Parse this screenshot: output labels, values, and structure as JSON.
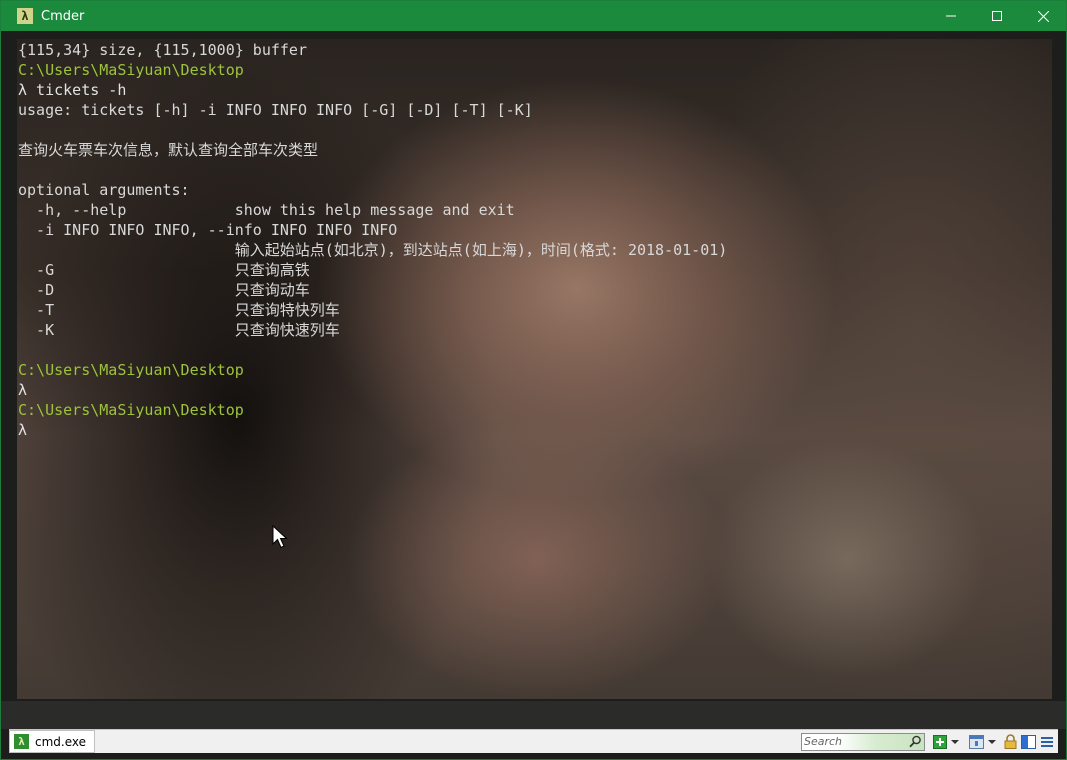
{
  "window": {
    "title": "Cmder",
    "app_icon_glyph": "λ"
  },
  "terminal": {
    "lines": [
      {
        "type": "out",
        "text": "{115,34} size, {115,1000} buffer"
      },
      {
        "type": "path",
        "text": "C:\\Users\\MaSiyuan\\Desktop"
      },
      {
        "type": "cmd",
        "text": "λ tickets -h"
      },
      {
        "type": "out",
        "text": "usage: tickets [-h] -i INFO INFO INFO [-G] [-D] [-T] [-K]"
      },
      {
        "type": "out",
        "text": ""
      },
      {
        "type": "out",
        "text": "查询火车票车次信息，默认查询全部车次类型"
      },
      {
        "type": "out",
        "text": ""
      },
      {
        "type": "out",
        "text": "optional arguments:"
      },
      {
        "type": "out",
        "text": "  -h, --help            show this help message and exit"
      },
      {
        "type": "out",
        "text": "  -i INFO INFO INFO, --info INFO INFO INFO"
      },
      {
        "type": "out",
        "text": "                        输入起始站点(如北京)，到达站点(如上海)，时间(格式: 2018-01-01)"
      },
      {
        "type": "out",
        "text": "  -G                    只查询高铁"
      },
      {
        "type": "out",
        "text": "  -D                    只查询动车"
      },
      {
        "type": "out",
        "text": "  -T                    只查询特快列车"
      },
      {
        "type": "out",
        "text": "  -K                    只查询快速列车"
      },
      {
        "type": "out",
        "text": ""
      },
      {
        "type": "path",
        "text": "C:\\Users\\MaSiyuan\\Desktop"
      },
      {
        "type": "cmd",
        "text": "λ"
      },
      {
        "type": "path",
        "text": "C:\\Users\\MaSiyuan\\Desktop"
      },
      {
        "type": "cmd",
        "text": "λ"
      }
    ]
  },
  "statusbar": {
    "tab_label": "cmd.exe",
    "tab_icon_glyph": "λ",
    "search_placeholder": "Search"
  },
  "icons": {
    "minimize": "minimize-icon",
    "maximize": "maximize-icon",
    "close": "close-icon",
    "search": "magnifier-icon",
    "new_console": "plus-icon",
    "new_console_menu": "chevron-down-icon",
    "tab_list": "window-icon",
    "tab_list_menu": "chevron-down-icon",
    "lock": "lock-icon",
    "split_view": "split-view-icon",
    "menu": "hamburger-icon"
  },
  "colors": {
    "titlebar": "#1b8a3c",
    "path_text": "#9dc43a",
    "plain_text": "#d8d8d8"
  }
}
